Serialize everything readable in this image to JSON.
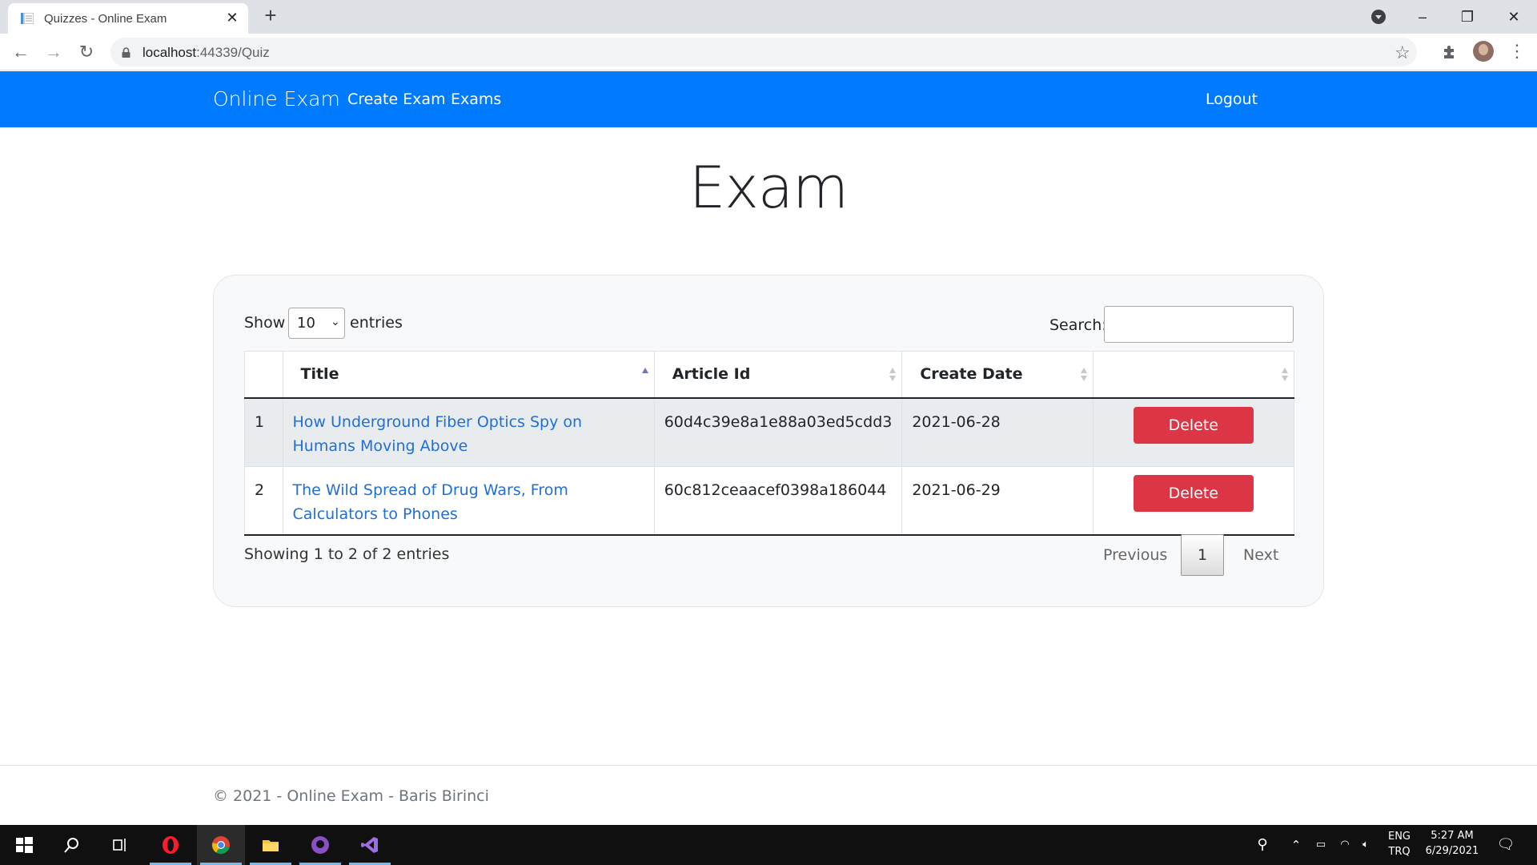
{
  "browser": {
    "tab_title": "Quizzes - Online Exam",
    "url_host": "localhost",
    "url_rest": ":44339/Quiz"
  },
  "navbar": {
    "brand": "Online Exam",
    "links": [
      "Create Exam",
      "Exams"
    ],
    "logout": "Logout"
  },
  "page": {
    "title": "Exam"
  },
  "table_controls": {
    "show_label": "Show",
    "entries_label": "entries",
    "page_length": "10",
    "search_label": "Search:",
    "search_value": ""
  },
  "table": {
    "columns": [
      "",
      "Title",
      "Article Id",
      "Create Date",
      ""
    ],
    "rows": [
      {
        "index": "1",
        "title": "How Underground Fiber Optics Spy on Humans Moving Above",
        "article_id": "60d4c39e8a1e88a03ed5cdd3",
        "create_date": "2021-06-28",
        "action": "Delete"
      },
      {
        "index": "2",
        "title": "The Wild Spread of Drug Wars, From Calculators to Phones",
        "article_id": "60c812ceaacef0398a186044",
        "create_date": "2021-06-29",
        "action": "Delete"
      }
    ]
  },
  "pagination": {
    "info": "Showing 1 to 2 of 2 entries",
    "previous": "Previous",
    "current": "1",
    "next": "Next"
  },
  "footer": {
    "text": "© 2021 - Online Exam - Baris Birinci"
  },
  "taskbar": {
    "lang_top": "ENG",
    "lang_bottom": "TRQ",
    "time": "5:27 AM",
    "date": "6/29/2021"
  },
  "colors": {
    "navbar": "#007bff",
    "danger": "#dc3545",
    "link": "#1f6fd6"
  }
}
